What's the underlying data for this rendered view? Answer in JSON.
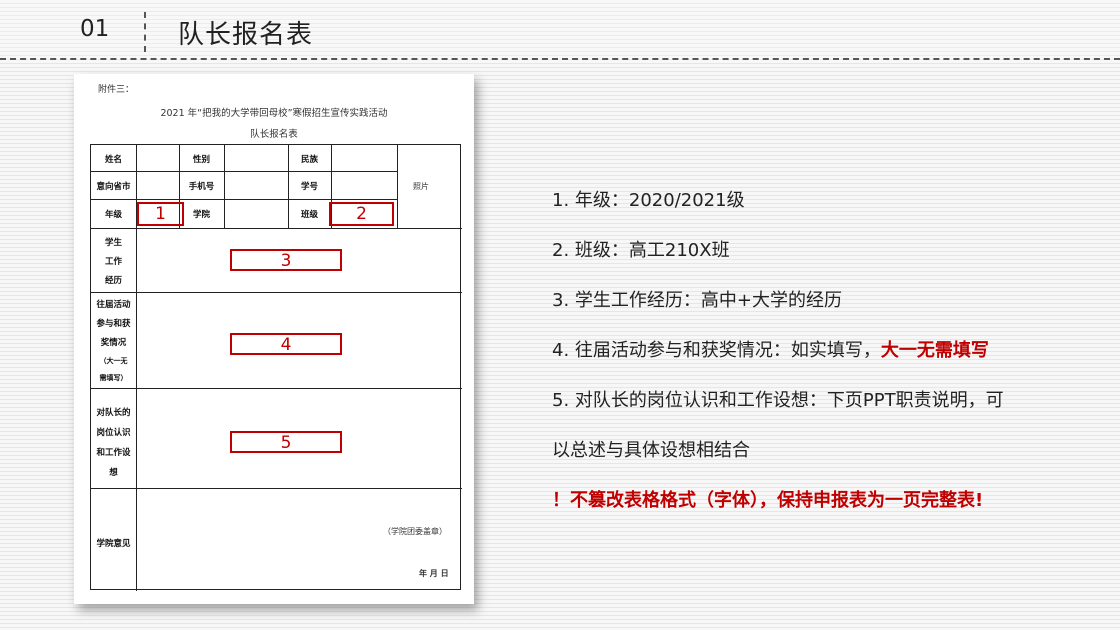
{
  "header": {
    "number": "01",
    "title": "队长报名表"
  },
  "document": {
    "attachment": "附件三：",
    "heading_line1": "2021 年“把我的大学带回母校”寒假招生宣传实践活动",
    "heading_line2": "队长报名表",
    "labels": {
      "name": "姓名",
      "gender": "性别",
      "ethnicity": "民族",
      "province": "意向省市",
      "phone": "手机号",
      "student_id": "学号",
      "grade": "年级",
      "school": "学院",
      "class": "班级",
      "photo": "照片",
      "work_1": "学生",
      "work_2": "工作",
      "work_3": "经历",
      "awards_1": "往届活动",
      "awards_2": "参与和获",
      "awards_3": "奖情况",
      "awards_4": "（大一无",
      "awards_5": "需填写）",
      "role_1": "对队长的",
      "role_2": "岗位认识",
      "role_3": "和工作设",
      "role_4": "想",
      "opinion": "学院意见",
      "seal": "（学院团委盖章）",
      "date": "年 月 日"
    },
    "markers": [
      "1",
      "2",
      "3",
      "4",
      "5"
    ]
  },
  "notes": {
    "item1": "1. 年级：2020/2021级",
    "item2": "2. 班级：高工210X班",
    "item3": "3. 学生工作经历：高中+大学的经历",
    "item4_main": "4. 往届活动参与和获奖情况：如实填写，",
    "item4_highlight": "大一无需填写",
    "item5_line1": "5. 对队长的岗位认识和工作设想：下页PPT职责说明，可",
    "item5_line2": "以总述与具体设想相结合",
    "warning": "！不篡改表格格式（字体），保持申报表为一页完整表!"
  },
  "colors": {
    "accent": "#c00000",
    "text": "#222222"
  }
}
